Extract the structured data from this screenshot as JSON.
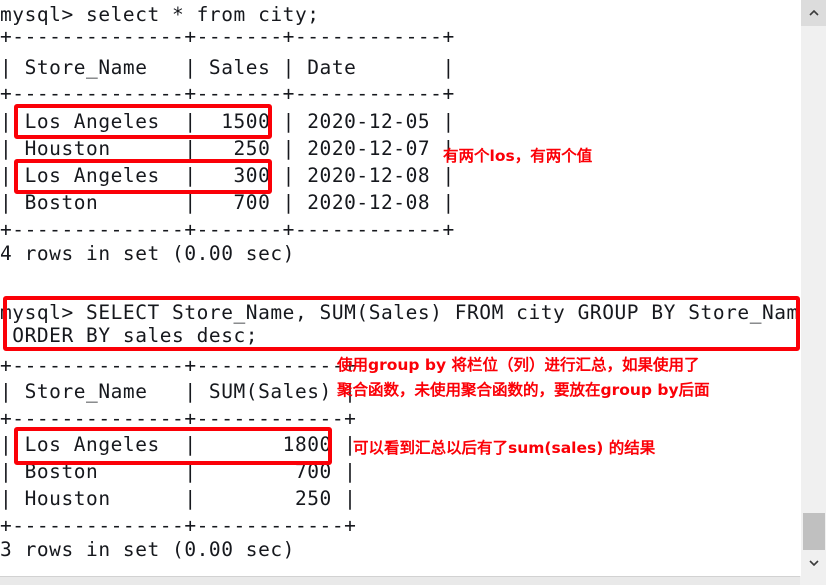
{
  "terminal": {
    "lines": [
      "mysql> select * from city;",
      "+--------------+-------+------------+",
      "| Store_Name   | Sales | Date       |",
      "+--------------+-------+------------+",
      "| Los Angeles  |  1500 | 2020-12-05 |",
      "| Houston      |   250 | 2020-12-07 |",
      "| Los Angeles  |   300 | 2020-12-08 |",
      "| Boston       |   700 | 2020-12-08 |",
      "+--------------+-------+------------+",
      "4 rows in set (0.00 sec)",
      "",
      "mysql> SELECT Store_Name, SUM(Sales) FROM city GROUP BY Store_Name",
      " ORDER BY sales desc;",
      "+--------------+------------+",
      "| Store_Name   | SUM(Sales) |",
      "+--------------+------------+",
      "| Los Angeles  |       1800 |",
      "| Boston       |        700 |",
      "| Houston      |        250 |",
      "+--------------+------------+",
      "3 rows in set (0.00 sec)"
    ],
    "first_query": "mysql> select * from city;",
    "second_query_line1": "mysql> SELECT Store_Name, SUM(Sales) FROM city GROUP BY Store_Name",
    "second_query_line2": " ORDER BY sales desc;",
    "first_result_count": "4 rows in set (0.00 sec)",
    "second_result_count": "3 rows in set (0.00 sec)"
  },
  "tables": {
    "city": {
      "columns": [
        "Store_Name",
        "Sales",
        "Date"
      ],
      "rows": [
        [
          "Los Angeles",
          "1500",
          "2020-12-05"
        ],
        [
          "Houston",
          "250",
          "2020-12-07"
        ],
        [
          "Los Angeles",
          "300",
          "2020-12-08"
        ],
        [
          "Boston",
          "700",
          "2020-12-08"
        ]
      ]
    },
    "grouped": {
      "columns": [
        "Store_Name",
        "SUM(Sales)"
      ],
      "rows": [
        [
          "Los Angeles",
          "1800"
        ],
        [
          "Boston",
          "700"
        ],
        [
          "Houston",
          "250"
        ]
      ]
    }
  },
  "annotations": {
    "note1": "有两个los，有两个值",
    "note2_line1": "使用group by 将栏位（列）进行汇总，如果使用了",
    "note2_line2": "聚合函数，未使用聚合函数的，要放在group by后面",
    "note3": "可以看到汇总以后有了sum(sales) 的结果"
  },
  "colors": {
    "highlight": "#fb0007",
    "text": "#16181d",
    "background": "#ffffff",
    "scrollbar_track": "#f0f0f0",
    "scrollbar_thumb": "#c0c0c0"
  },
  "scrollbar": {
    "up_arrow": "chevron-up-icon",
    "down_arrow": "chevron-down-icon"
  }
}
